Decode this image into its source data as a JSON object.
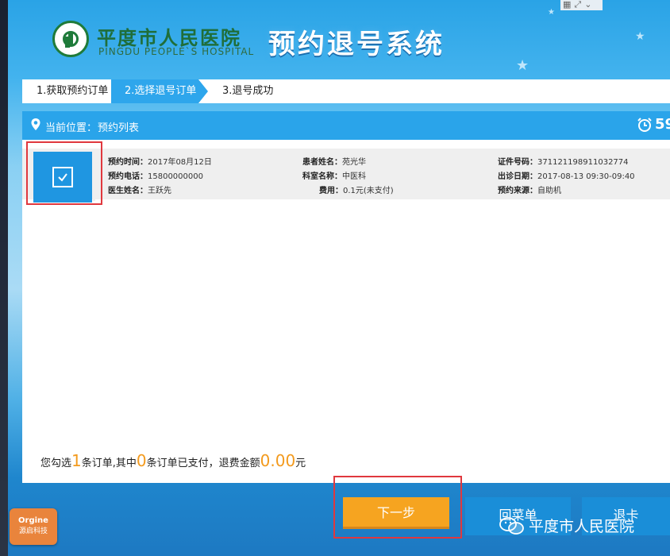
{
  "header": {
    "hospital_name_cn": "平度市人民医院",
    "hospital_name_en": "PINGDU PEOPLE`S HOSPITAL",
    "system_title": "预约退号系统"
  },
  "steps": [
    {
      "label": "1.获取预约订单",
      "active": false
    },
    {
      "label": "2.选择退号订单",
      "active": true
    },
    {
      "label": "3.退号成功",
      "active": false
    }
  ],
  "panel": {
    "location_label": "当前位置：",
    "location_value": "预约列表",
    "countdown": "59"
  },
  "record": {
    "selected": true,
    "fields": [
      {
        "label": "预约时间：",
        "value": "2017年08月12日"
      },
      {
        "label": "患者姓名：",
        "value": "苑光华"
      },
      {
        "label": "证件号码：",
        "value": "371121198911032774"
      },
      {
        "label": "预约电话：",
        "value": "15800000000"
      },
      {
        "label": "科室名称：",
        "value": "中医科"
      },
      {
        "label": "出诊日期：",
        "value": "2017-08-13 09:30-09:40"
      },
      {
        "label": "医生姓名：",
        "value": "王跃先"
      },
      {
        "label": "费用：",
        "value": "0.1元(未支付)"
      },
      {
        "label": "预约来源：",
        "value": "自助机"
      }
    ]
  },
  "summary": {
    "prefix": "您勾选",
    "selected_count": "1",
    "mid1": "条订单,其中",
    "paid_count": "0",
    "mid2": "条订单已支付，退费金额",
    "refund_amount": "0.00",
    "suffix": "元"
  },
  "buttons": {
    "next": "下一步",
    "menu": "回菜单",
    "card": "退卡"
  },
  "branding": {
    "origin_en": "Orgine",
    "origin_cn": "源启科技",
    "watermark": "平度市人民医院"
  },
  "colors": {
    "accent_blue": "#2aa4ea",
    "next_orange": "#f6a420",
    "highlight_red": "#e0383e",
    "hospital_green": "#1f6e3a"
  }
}
